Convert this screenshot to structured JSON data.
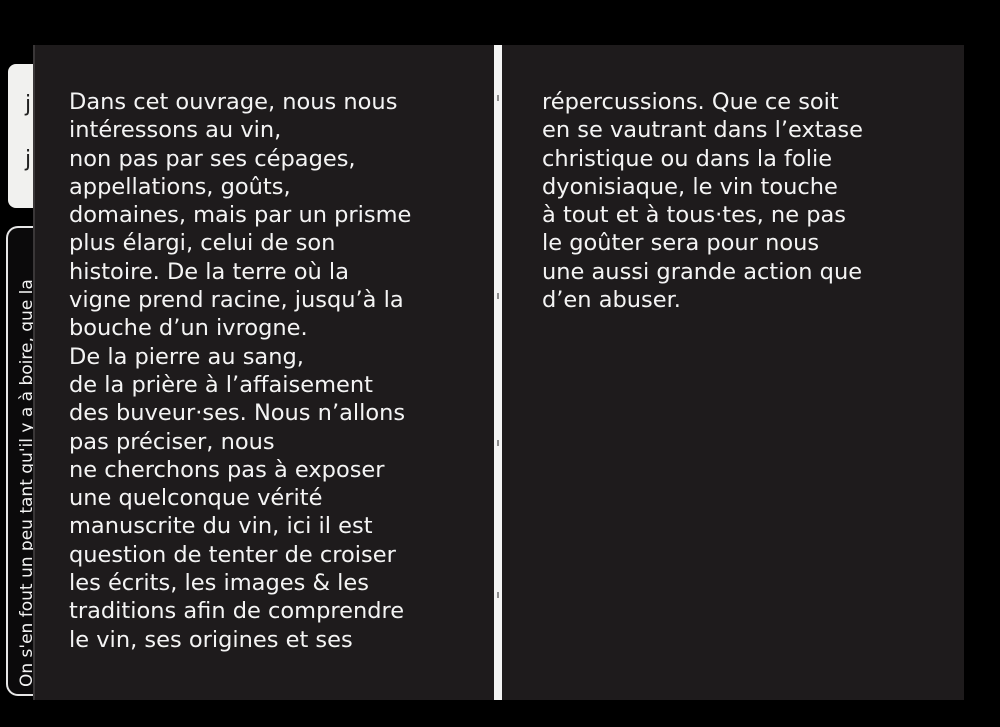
{
  "side_tab": {
    "upper_chars": [
      "j",
      "j"
    ],
    "spine_text": "On s'en fout un peu tant qu'il y a à boire, que la"
  },
  "left_page": {
    "lines": [
      "Dans cet ouvrage, nous nous",
      "intéressons au vin,",
      "non pas par ses cépages,",
      "appellations, goûts,",
      "domaines, mais par un prisme",
      "plus élargi, celui de son",
      "histoire. De la terre où la",
      "vigne prend racine, jusqu’à la",
      "bouche d’un ivrogne.",
      "De la pierre au sang,",
      "de la prière à l’affaisement",
      "des buveur·ses. Nous n’allons",
      "pas préciser, nous",
      "ne cherchons pas à exposer",
      "une quelconque vérité",
      "manuscrite du vin, ici il est",
      "question de tenter de croiser",
      "les écrits, les images & les",
      "traditions afin de comprendre",
      "le vin, ses origines et ses"
    ]
  },
  "right_page": {
    "lines": [
      "répercussions. Que ce soit",
      "en se vautrant dans l’extase",
      "christique ou dans la folie",
      "dyonisiaque, le vin touche",
      "à tout et à tous·tes, ne pas",
      "le goûter sera pour nous",
      "une aussi grande action que",
      "d’en abuser."
    ]
  },
  "colors": {
    "page_background": "#1e1b1c",
    "text": "#f4f4f4",
    "scan_background": "#000000",
    "gutter": "#f4f4f4"
  }
}
